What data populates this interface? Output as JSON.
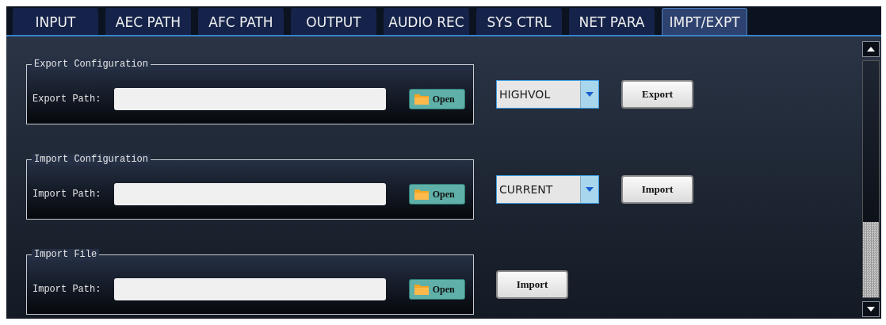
{
  "tabs": [
    {
      "label": "INPUT",
      "selected": false
    },
    {
      "label": "AEC PATH",
      "selected": false
    },
    {
      "label": "AFC PATH",
      "selected": false
    },
    {
      "label": "OUTPUT",
      "selected": false
    },
    {
      "label": "AUDIO REC",
      "selected": false
    },
    {
      "label": "SYS CTRL",
      "selected": false
    },
    {
      "label": "NET PARA",
      "selected": false
    },
    {
      "label": "IMPT/EXPT",
      "selected": true
    }
  ],
  "sections": [
    {
      "title": "Export Configuration",
      "path_label": "Export Path:",
      "open_button": "Open",
      "dropdown": "HIGHVOL",
      "action_button": "Export"
    },
    {
      "title": "Import Configuration",
      "path_label": "Import Path:",
      "open_button": "Open",
      "dropdown": "CURRENT",
      "action_button": "Import"
    },
    {
      "title": "Import File",
      "path_label": "Import Path:",
      "open_button": "Open",
      "action_button": "Import"
    }
  ]
}
